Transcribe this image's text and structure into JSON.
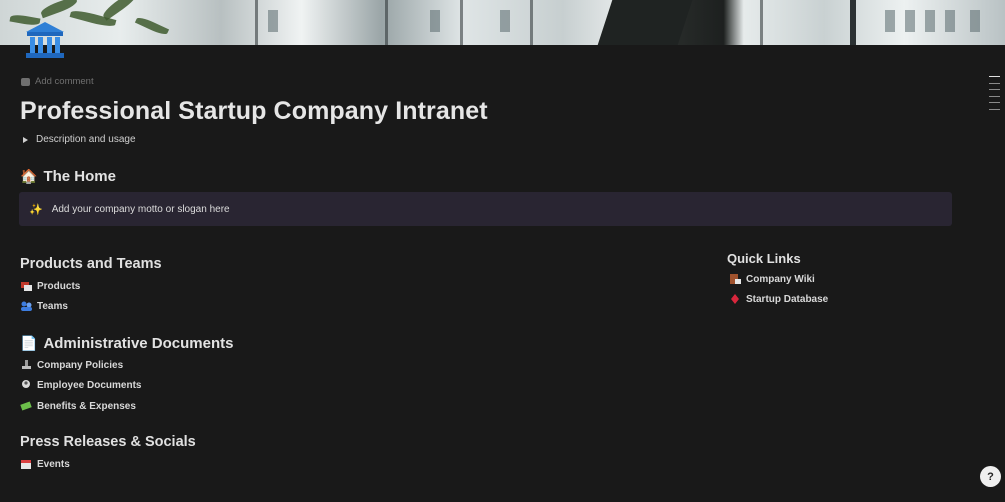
{
  "page": {
    "add_comment": "Add comment",
    "title": "Professional Startup Company Intranet",
    "toggle_label": "Description and usage",
    "icon": "building-columns-icon"
  },
  "home": {
    "emoji": "🏠",
    "heading": "The Home",
    "callout_icon": "✨",
    "callout_text": "Add your company motto or slogan here"
  },
  "sections": {
    "products_teams": {
      "heading": "Products and Teams",
      "links": [
        {
          "icon": "boxes-icon",
          "label": "Products"
        },
        {
          "icon": "people-icon",
          "label": "Teams"
        }
      ]
    },
    "admin_docs": {
      "emoji": "📄",
      "heading": "Administrative Documents",
      "links": [
        {
          "icon": "stamp-icon",
          "label": "Company Policies"
        },
        {
          "icon": "person-doc-icon",
          "label": "Employee Documents"
        },
        {
          "icon": "money-icon",
          "label": "Benefits & Expenses"
        }
      ]
    },
    "press": {
      "heading": "Press Releases & Socials",
      "links": [
        {
          "icon": "calendar-icon",
          "label": "Events"
        }
      ]
    },
    "quick_links": {
      "heading": "Quick Links",
      "links": [
        {
          "icon": "wiki-book-icon",
          "label": "Company Wiki"
        },
        {
          "icon": "diamond-icon",
          "label": "Startup Database"
        }
      ]
    }
  },
  "help": {
    "label": "?"
  },
  "colors": {
    "background": "#191919",
    "callout_bg": "#292532",
    "text": "#d4d4d4"
  }
}
